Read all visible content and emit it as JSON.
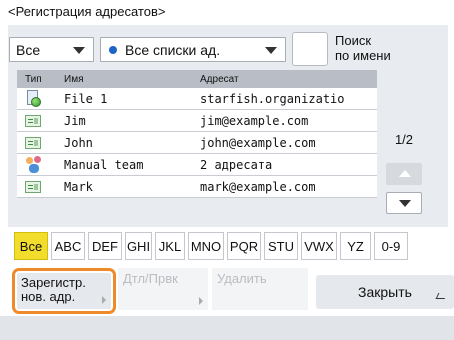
{
  "title": "<Регистрация адресатов>",
  "filters": {
    "type_value": "Все",
    "list_value": "Все списки ад."
  },
  "search_by_name": {
    "line1": "Поиск",
    "line2": "по имени"
  },
  "table": {
    "headers": {
      "type": "Тип",
      "name": "Имя",
      "address": "Адресат"
    },
    "rows": [
      {
        "icon": "file-globe-icon",
        "name": "File 1",
        "address": "starfish.organizatio"
      },
      {
        "icon": "address-card-icon",
        "name": "Jim",
        "address": "jim@example.com"
      },
      {
        "icon": "address-card-icon",
        "name": "John",
        "address": "john@example.com"
      },
      {
        "icon": "group-icon",
        "name": "Manual team",
        "address": "2 адресата"
      },
      {
        "icon": "address-card-icon",
        "name": "Mark",
        "address": "mark@example.com"
      }
    ]
  },
  "pager": {
    "text": "1/2"
  },
  "alpha_keys": [
    "Все",
    "ABC",
    "DEF",
    "GHI",
    "JKL",
    "MNO",
    "PQR",
    "STU",
    "VWX",
    "YZ",
    "0-9"
  ],
  "buttons": {
    "register_line1": "Зарегистр.",
    "register_line2": "нов. адр.",
    "edit": "Дтл/Првк",
    "delete": "Удалить",
    "close": "Закрыть"
  },
  "colors": {
    "active_key": "#f2dc2c",
    "highlight_outline": "#ee8a2a",
    "list_dot": "#1e63c6"
  }
}
